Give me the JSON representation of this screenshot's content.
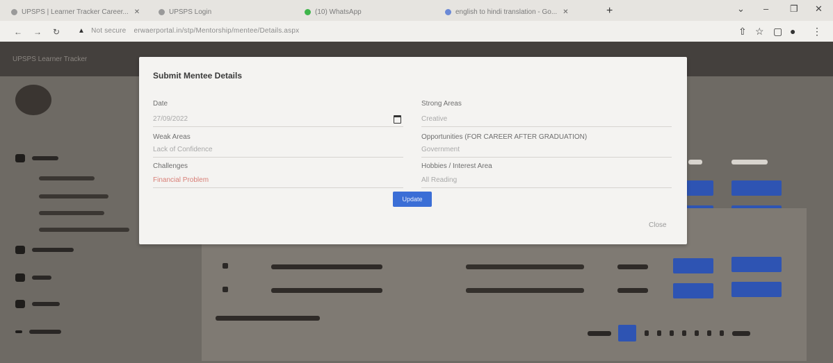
{
  "browser": {
    "tabs": [
      {
        "label": "UPSPS | Learner Tracker Career..."
      },
      {
        "label": "UPSPS Login"
      },
      {
        "label": "(10) WhatsApp"
      },
      {
        "label": "english to hindi translation - Go..."
      }
    ],
    "url": "erwaerportal.in/stp/Mentorship/mentee/Details.aspx",
    "secure_label": "Not secure"
  },
  "app": {
    "title": "UPSPS Learner Tracker"
  },
  "modal": {
    "title": "Submit Mentee Details",
    "date_label": "Date",
    "date_value": "27/09/2022",
    "strong_label": "Strong Areas",
    "strong_value": "Creative",
    "weak_label": "Weak Areas",
    "weak_value": "Lack of Confidence",
    "opportunities_label": "Opportunities (FOR CAREER AFTER GRADUATION)",
    "opportunities_value": "Government",
    "challenges_label": "Challenges",
    "challenges_value": "Financial Problem",
    "hobbies_label": "Hobbies / Interest Area",
    "hobbies_value": "All Reading",
    "update_label": "Update",
    "close_label": "Close"
  },
  "colors": {
    "accent": "#3b6ed6",
    "table_button": "#2e54b3"
  }
}
